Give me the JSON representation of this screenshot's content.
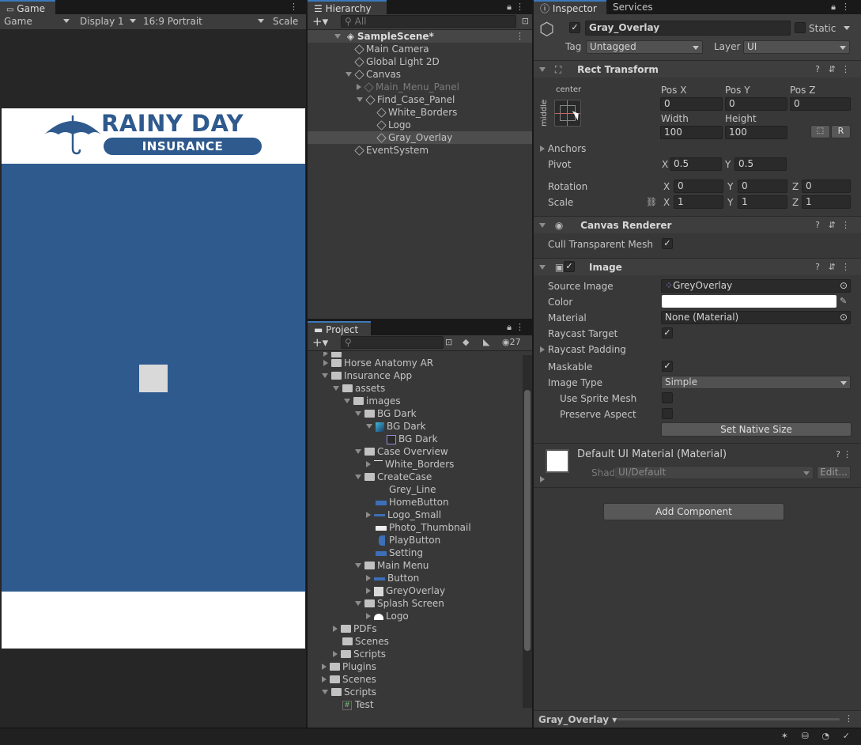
{
  "game": {
    "tab": "Game",
    "mode": "Game",
    "display": "Display 1",
    "aspect": "16:9 Portrait",
    "scale_label": "Scale",
    "logo_line1": "RAINY DAY",
    "logo_line2": "INSURANCE",
    "colors": {
      "brand_blue": "#2f5a8e",
      "overlay": "#d9d9d9",
      "white": "#ffffff"
    }
  },
  "hierarchy": {
    "tab": "Hierarchy",
    "search_placeholder": "All",
    "items": [
      {
        "label": "SampleScene*"
      },
      {
        "label": "Main Camera"
      },
      {
        "label": "Global Light 2D"
      },
      {
        "label": "Canvas"
      },
      {
        "label": "Main_Menu_Panel"
      },
      {
        "label": "Find_Case_Panel"
      },
      {
        "label": "White_Borders"
      },
      {
        "label": "Logo"
      },
      {
        "label": "Gray_Overlay"
      },
      {
        "label": "EventSystem"
      }
    ]
  },
  "project": {
    "tab": "Project",
    "hidden_count": "27",
    "items": [
      {
        "label": "Horse Anatomy AR"
      },
      {
        "label": "Insurance App"
      },
      {
        "label": "assets"
      },
      {
        "label": "images"
      },
      {
        "label": "BG Dark"
      },
      {
        "label": "BG Dark"
      },
      {
        "label": "BG Dark"
      },
      {
        "label": "Case Overview"
      },
      {
        "label": "White_Borders"
      },
      {
        "label": "CreateCase"
      },
      {
        "label": "Grey_Line"
      },
      {
        "label": "HomeButton"
      },
      {
        "label": "Logo_Small"
      },
      {
        "label": "Photo_Thumbnail"
      },
      {
        "label": "PlayButton"
      },
      {
        "label": "Setting"
      },
      {
        "label": "Main Menu"
      },
      {
        "label": "Button"
      },
      {
        "label": "GreyOverlay"
      },
      {
        "label": "Splash Screen"
      },
      {
        "label": "Logo"
      },
      {
        "label": "PDFs"
      },
      {
        "label": "Scenes"
      },
      {
        "label": "Scripts"
      },
      {
        "label": "Plugins"
      },
      {
        "label": "Scenes"
      },
      {
        "label": "Scripts"
      },
      {
        "label": "Test"
      }
    ]
  },
  "inspector": {
    "tab": "Inspector",
    "tab2": "Services",
    "object_name": "Gray_Overlay",
    "static_label": "Static",
    "tag_label": "Tag",
    "tag_value": "Untagged",
    "layer_label": "Layer",
    "layer_value": "UI",
    "rect": {
      "title": "Rect Transform",
      "anchor_h": "center",
      "anchor_v": "middle",
      "posx_label": "Pos X",
      "posy_label": "Pos Y",
      "posz_label": "Pos Z",
      "posx": "0",
      "posy": "0",
      "posz": "0",
      "width_label": "Width",
      "height_label": "Height",
      "width": "100",
      "height": "100",
      "r_btn": "R",
      "anchors_label": "Anchors",
      "pivot_label": "Pivot",
      "pivot_x": "0.5",
      "pivot_y": "0.5",
      "rotation_label": "Rotation",
      "rot_x": "0",
      "rot_y": "0",
      "rot_z": "0",
      "scale_label": "Scale",
      "scale_x": "1",
      "scale_y": "1",
      "scale_z": "1",
      "x": "X",
      "y": "Y",
      "z": "Z"
    },
    "canvas_renderer": {
      "title": "Canvas Renderer",
      "cull_label": "Cull Transparent Mesh"
    },
    "image": {
      "title": "Image",
      "source_label": "Source Image",
      "source_value": "GreyOverlay",
      "color_label": "Color",
      "material_label": "Material",
      "material_value": "None (Material)",
      "raycast_target_label": "Raycast Target",
      "raycast_padding_label": "Raycast Padding",
      "maskable_label": "Maskable",
      "image_type_label": "Image Type",
      "image_type_value": "Simple",
      "use_sprite_mesh_label": "Use Sprite Mesh",
      "preserve_aspect_label": "Preserve Aspect",
      "native_size_button": "Set Native Size"
    },
    "material": {
      "title": "Default UI Material (Material)",
      "shader_label": "Shader",
      "shader_value": "UI/Default",
      "edit_button": "Edit..."
    },
    "add_component": "Add Component",
    "footer_object": "Gray_Overlay"
  }
}
